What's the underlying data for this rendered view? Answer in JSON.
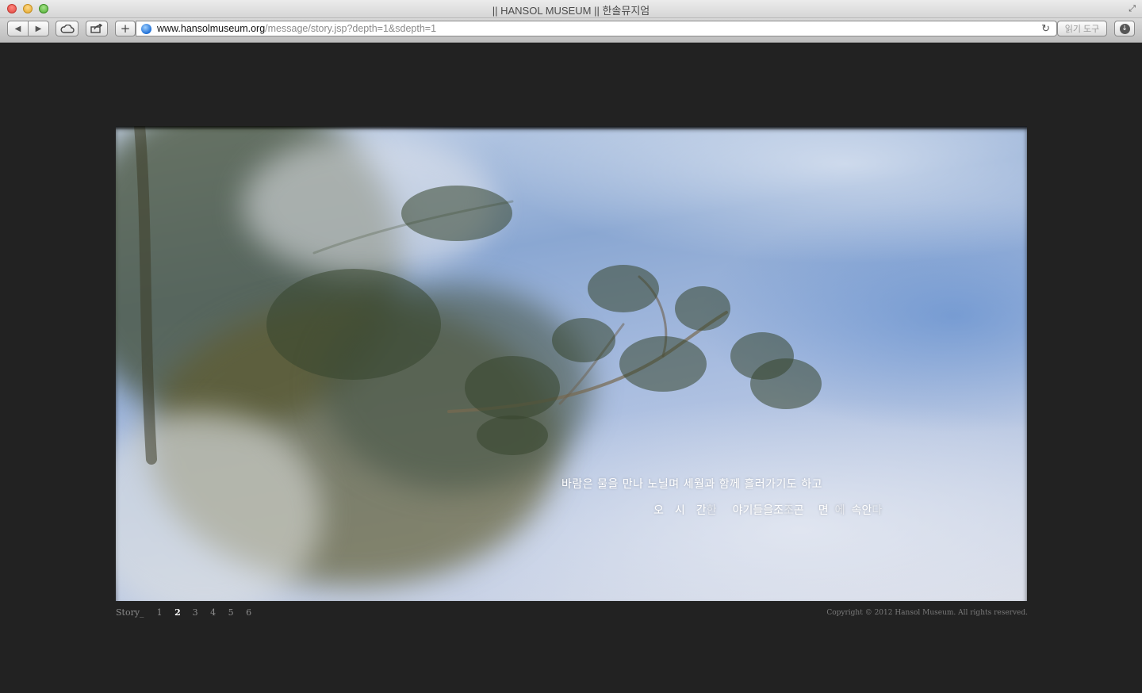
{
  "browser": {
    "window_title": "|| HANSOL MUSEUM || 한솔뮤지엄",
    "url_host": "www.hansolmuseum.org",
    "url_path": "/message/story.jsp?depth=1&sdepth=1",
    "reader_label": "읽기 도구",
    "add_label": "+",
    "back_icon": "◀",
    "forward_icon": "▶",
    "reload_icon": "↻",
    "download_icon": "↓",
    "fullscreen_icon": "⤢"
  },
  "story": {
    "caption_line1": "바람은 물을 만나 노닐며 세월과 함께 흘러가기도 하고",
    "caption_line2_chars": [
      {
        "t": "오",
        "dim": false
      },
      {
        "t": "시",
        "dim": false
      },
      {
        "t": "간",
        "dim": false
      },
      {
        "t": "한",
        "dim": true
      },
      {
        "t": "야기들을",
        "dim": false
      },
      {
        "t": "조",
        "dim": false
      },
      {
        "t": "조",
        "dim": true
      },
      {
        "t": "곤",
        "dim": false
      },
      {
        "t": "면",
        "dim": false
      },
      {
        "t": "에",
        "dim": true
      },
      {
        "t": "속",
        "dim": false
      },
      {
        "t": "안",
        "dim": false
      },
      {
        "t": "다",
        "dim": true
      }
    ],
    "nav_label": "Story_",
    "pages": [
      "1",
      "2",
      "3",
      "4",
      "5",
      "6"
    ],
    "active_page": "2"
  },
  "footer": {
    "copyright": "Copyright © 2012 Hansol Museum. All rights reserved."
  }
}
